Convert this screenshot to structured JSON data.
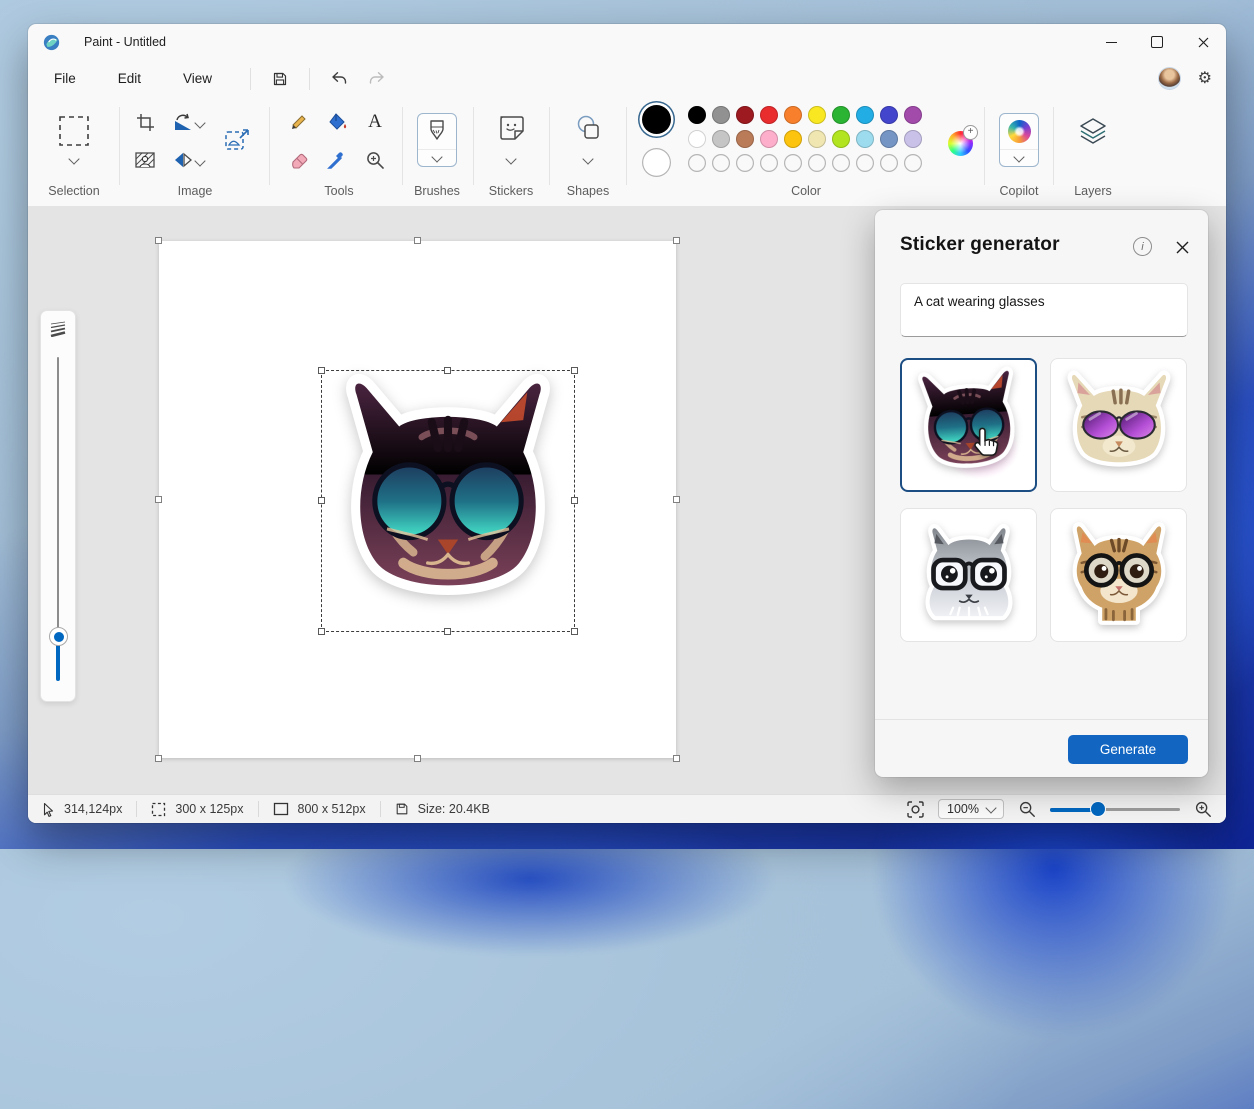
{
  "window": {
    "title": "Paint - Untitled"
  },
  "menu": {
    "items": [
      "File",
      "Edit",
      "View"
    ]
  },
  "ribbon": {
    "groups": {
      "selection": "Selection",
      "image": "Image",
      "tools": "Tools",
      "brushes": "Brushes",
      "stickers": "Stickers",
      "shapes": "Shapes",
      "color": "Color",
      "copilot": "Copilot",
      "layers": "Layers"
    },
    "palette": {
      "primary": "#000000",
      "secondary": "#ffffff",
      "row1": [
        "#000000",
        "#919191",
        "#9c1a20",
        "#e92c2e",
        "#f8802c",
        "#f9e821",
        "#2bb334",
        "#22aee5",
        "#4345cd",
        "#a24bab"
      ],
      "row2": [
        "#ffffff",
        "#c5c5c5",
        "#ba7b58",
        "#fcaecb",
        "#fcc40e",
        "#f0e6b2",
        "#b2e520",
        "#9cdcee",
        "#7595c4",
        "#c9c1e8"
      ]
    }
  },
  "panel": {
    "title": "Sticker generator",
    "prompt": "A cat wearing glasses",
    "generate_label": "Generate",
    "accent_color": "#1266c2",
    "stickers": [
      "Stylized purple cat with teal gradient sunglasses (selected)",
      "Tabby cat with purple sunglasses",
      "Gray cartoon cat with black glasses",
      "Brown tabby kitten with round glasses"
    ],
    "selected_index": 0
  },
  "statusbar": {
    "cursor_pos": "314,124px",
    "selection_size": "300  x  125px",
    "canvas_size": "800  x  512px",
    "file_size": "Size: 20.4KB",
    "zoom_level": "100%"
  }
}
